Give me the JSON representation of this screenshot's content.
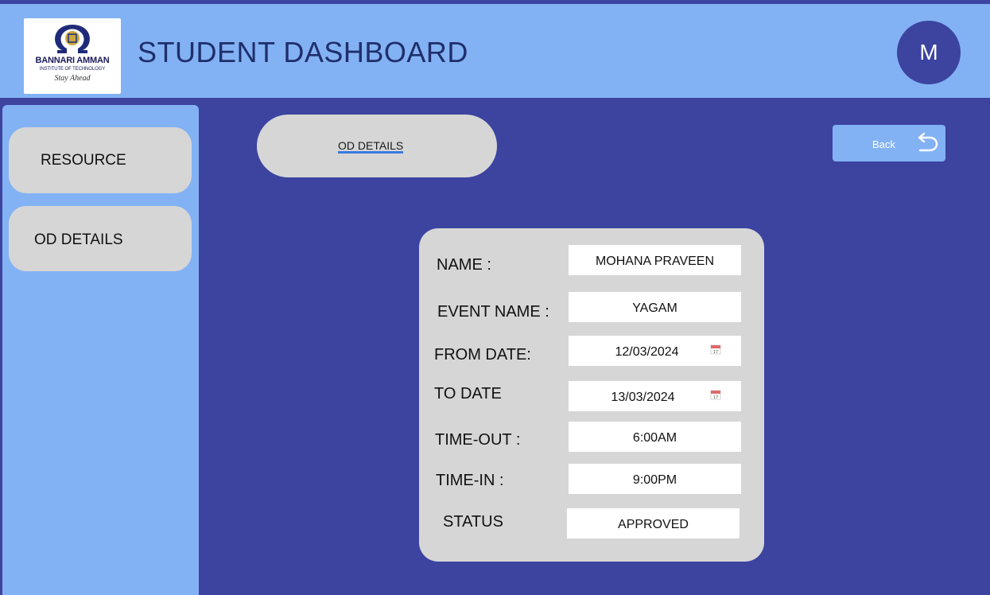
{
  "header": {
    "title": "STUDENT DASHBOARD",
    "logo": {
      "name": "BANNARI AMMAN",
      "subtitle": "INSTITUTE OF TECHNOLOGY",
      "tagline": "Stay Ahead"
    },
    "avatar_initial": "M"
  },
  "sidebar": {
    "items": [
      {
        "label": "RESOURCE"
      },
      {
        "label": "OD DETAILS"
      }
    ]
  },
  "tab": {
    "label": "OD DETAILS"
  },
  "back_button": {
    "label": "Back",
    "icon": "undo-arrow-icon"
  },
  "form": {
    "fields": [
      {
        "label": "NAME :",
        "value": "MOHANA PRAVEEN"
      },
      {
        "label": "EVENT NAME :",
        "value": "YAGAM"
      },
      {
        "label": "FROM DATE:",
        "value": "12/03/2024",
        "icon": "calendar-icon"
      },
      {
        "label": "TO DATE",
        "value": "13/03/2024",
        "icon": "calendar-icon"
      },
      {
        "label": "TIME-OUT :",
        "value": "6:00AM"
      },
      {
        "label": "TIME-IN :",
        "value": "9:00PM"
      },
      {
        "label": "STATUS",
        "value": "APPROVED"
      }
    ]
  },
  "colors": {
    "header_bg": "#83b2f4",
    "main_bg": "#3c44a0",
    "card_bg": "#d6d6d6",
    "avatar_bg": "#3c449f",
    "title_text": "#1f2f6b"
  }
}
